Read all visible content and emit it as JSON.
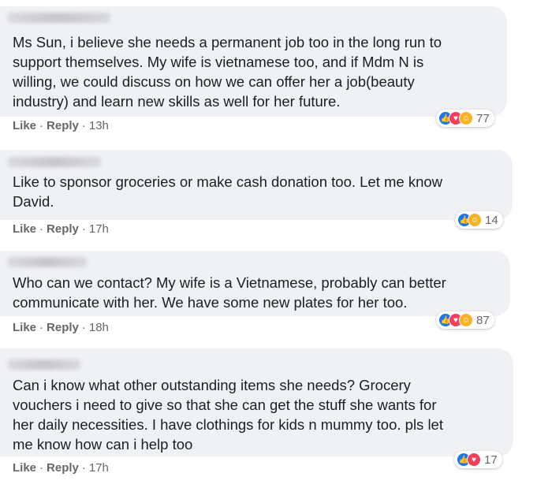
{
  "comments": [
    {
      "text": "Ms Sun, i believe she needs a permanent job too in the long run to\nsupport themselves. My wife is vietnamese too, and if Mdm N is\nwilling, we could discuss on how we can offer her a job(beauty\nindustry) and learn new skills as well for her future.",
      "like_label": "Like",
      "reply_label": "Reply",
      "time": "13h",
      "reaction_count": "77",
      "reactions": [
        "like-icon",
        "love-icon",
        "care-icon"
      ]
    },
    {
      "text": "Like to sponsor groceries or make cash donation too. Let me know\nDavid.",
      "like_label": "Like",
      "reply_label": "Reply",
      "time": "17h",
      "reaction_count": "14",
      "reactions": [
        "like-icon",
        "care-icon"
      ]
    },
    {
      "text": "Who can we contact? My wife is a Vietnamese, probably can better\ncommunicate with her. We have some new plates for her too.",
      "like_label": "Like",
      "reply_label": "Reply",
      "time": "18h",
      "reaction_count": "87",
      "reactions": [
        "like-icon",
        "love-icon",
        "care-icon"
      ]
    },
    {
      "text": "Can i know what other outstanding items she needs? Grocery\nvouchers i need to give so that she can get the stuff she wants for\nher daily necessities. I have clothings for kids n mummy too. pls let\nme know how can i help too",
      "like_label": "Like",
      "reply_label": "Reply",
      "time": "17h",
      "reaction_count": "17",
      "reactions": [
        "like-icon",
        "love-icon"
      ]
    }
  ],
  "colors": {
    "bubble": "#eff1f4",
    "text": "#1c1e21",
    "meta": "#65676b",
    "like": "#1877f2",
    "love": "#f33e58",
    "care": "#f7b125"
  }
}
